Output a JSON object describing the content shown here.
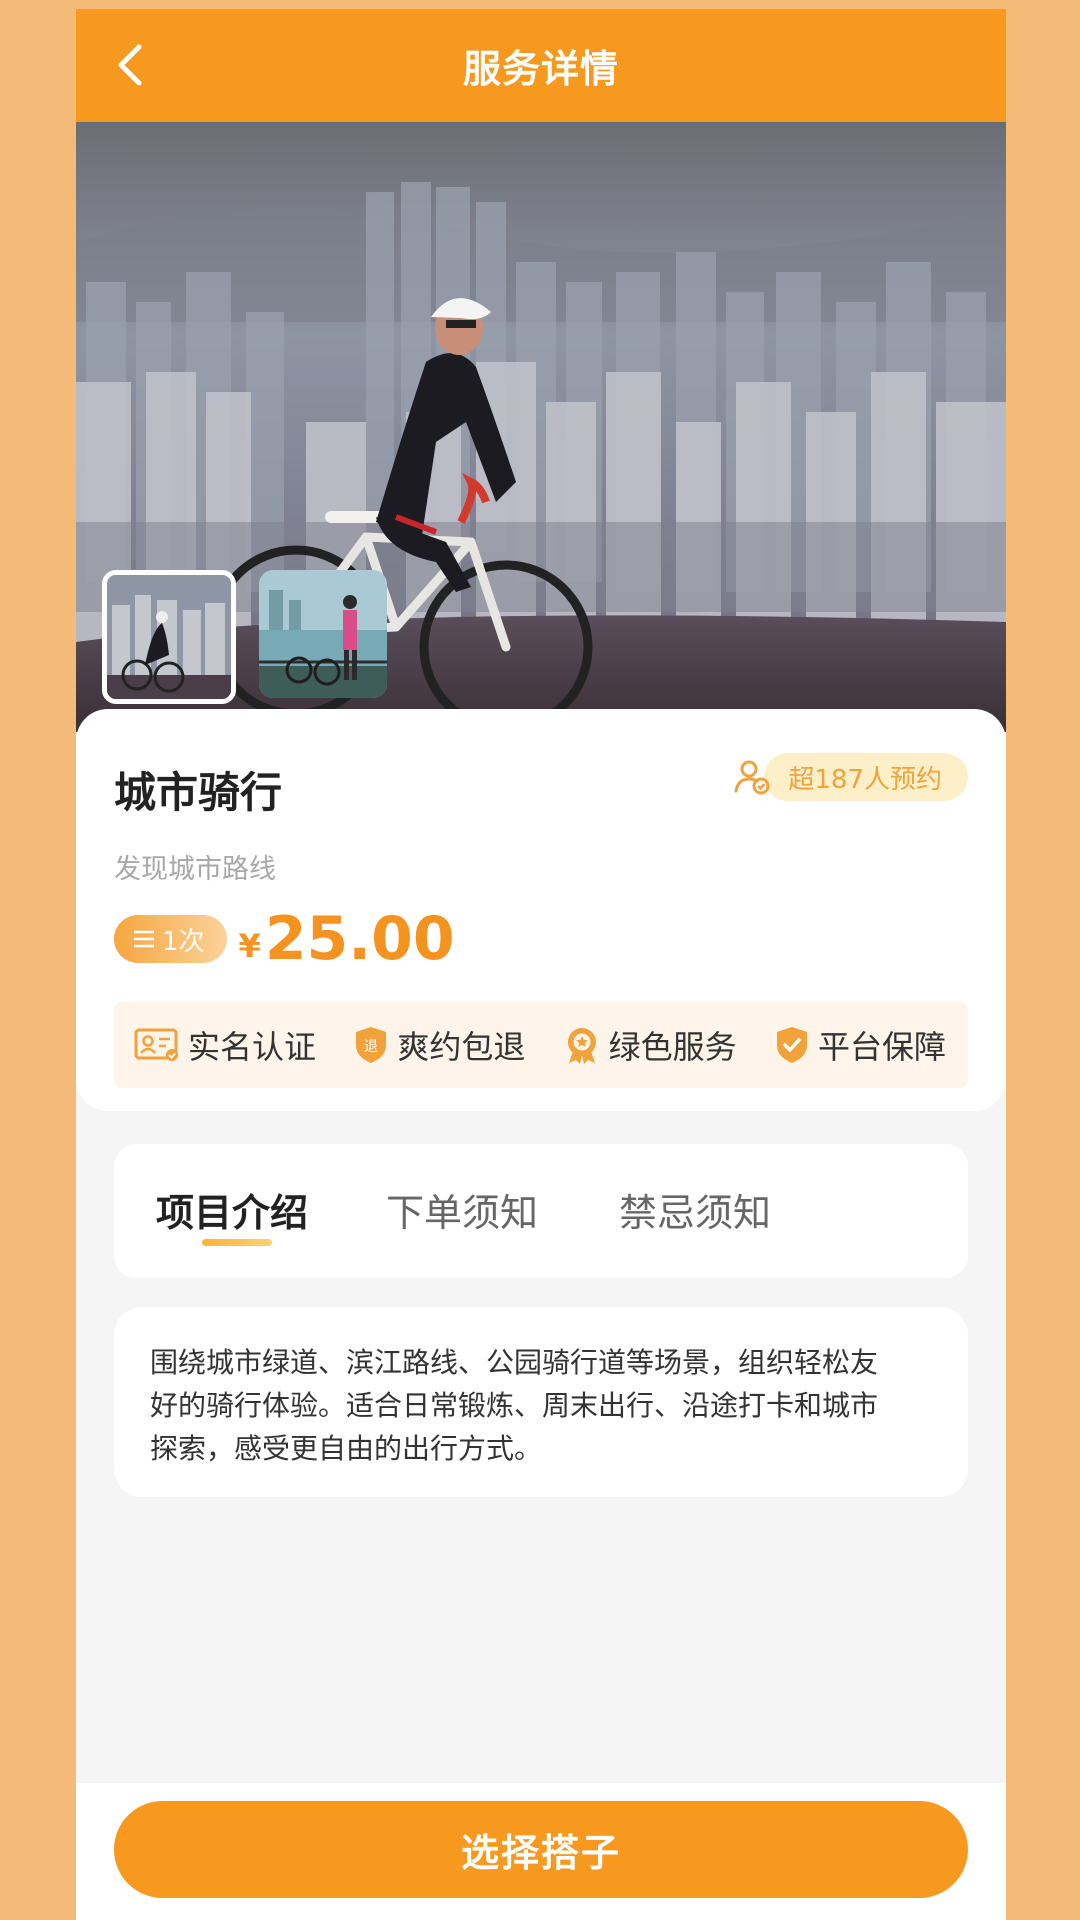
{
  "header": {
    "title": "服务详情",
    "back_icon": "chevron-left-icon"
  },
  "hero": {
    "thumbnails": [
      {
        "name": "thumbnail-cyclist-city",
        "selected": true
      },
      {
        "name": "thumbnail-cyclist-lake",
        "selected": false
      }
    ]
  },
  "service": {
    "title": "城市骑行",
    "booked_text": "超187人预约",
    "subtitle": "发现城市路线",
    "unit_label": "1次",
    "currency": "¥",
    "price": "25.00"
  },
  "guarantees": [
    {
      "label": "实名认证",
      "icon": "id-card-icon"
    },
    {
      "label": "爽约包退",
      "icon": "refund-shield-icon",
      "badge": "退"
    },
    {
      "label": "绿色服务",
      "icon": "medal-icon"
    },
    {
      "label": "平台保障",
      "icon": "shield-check-icon"
    }
  ],
  "tabs": [
    {
      "label": "项目介绍",
      "active": true
    },
    {
      "label": "下单须知",
      "active": false
    },
    {
      "label": "禁忌须知",
      "active": false
    }
  ],
  "description": {
    "lines": [
      "围绕城市绿道、滨江路线、公园骑行道等场景，组织轻松友",
      "好的骑行体验。适合日常锻炼、周末出行、沿途打卡和城市",
      "探索，感受更自由的出行方式。"
    ]
  },
  "cta": {
    "label": "选择搭子"
  },
  "colors": {
    "accent": "#F7991F",
    "price": "#F59320",
    "page_bg": "#F3BA78"
  }
}
